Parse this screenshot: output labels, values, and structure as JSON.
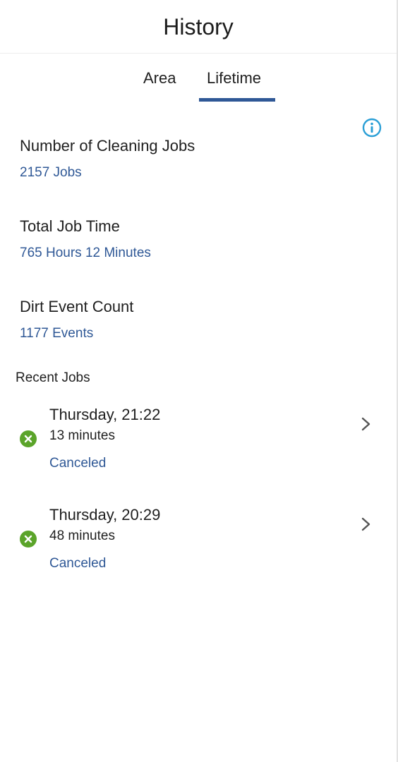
{
  "header": {
    "title": "History"
  },
  "tabs": [
    {
      "label": "Area",
      "selected": false
    },
    {
      "label": "Lifetime",
      "selected": true
    }
  ],
  "stats": {
    "jobs": {
      "label": "Number of Cleaning Jobs",
      "value": "2157 Jobs"
    },
    "time": {
      "label": "Total Job Time",
      "value": "765 Hours 12 Minutes"
    },
    "dirt": {
      "label": "Dirt Event Count",
      "value": "1177 Events"
    }
  },
  "recent": {
    "heading": "Recent Jobs",
    "jobs": [
      {
        "date": "Thursday, 21:22",
        "duration": "13 minutes",
        "status": "Canceled",
        "status_icon": "cancel-circle-icon"
      },
      {
        "date": "Thursday, 20:29",
        "duration": "48 minutes",
        "status": "Canceled",
        "status_icon": "cancel-circle-icon"
      }
    ]
  },
  "colors": {
    "accent": "#2f5896",
    "info_icon": "#2b9fd6",
    "status_green": "#5ba42a"
  }
}
